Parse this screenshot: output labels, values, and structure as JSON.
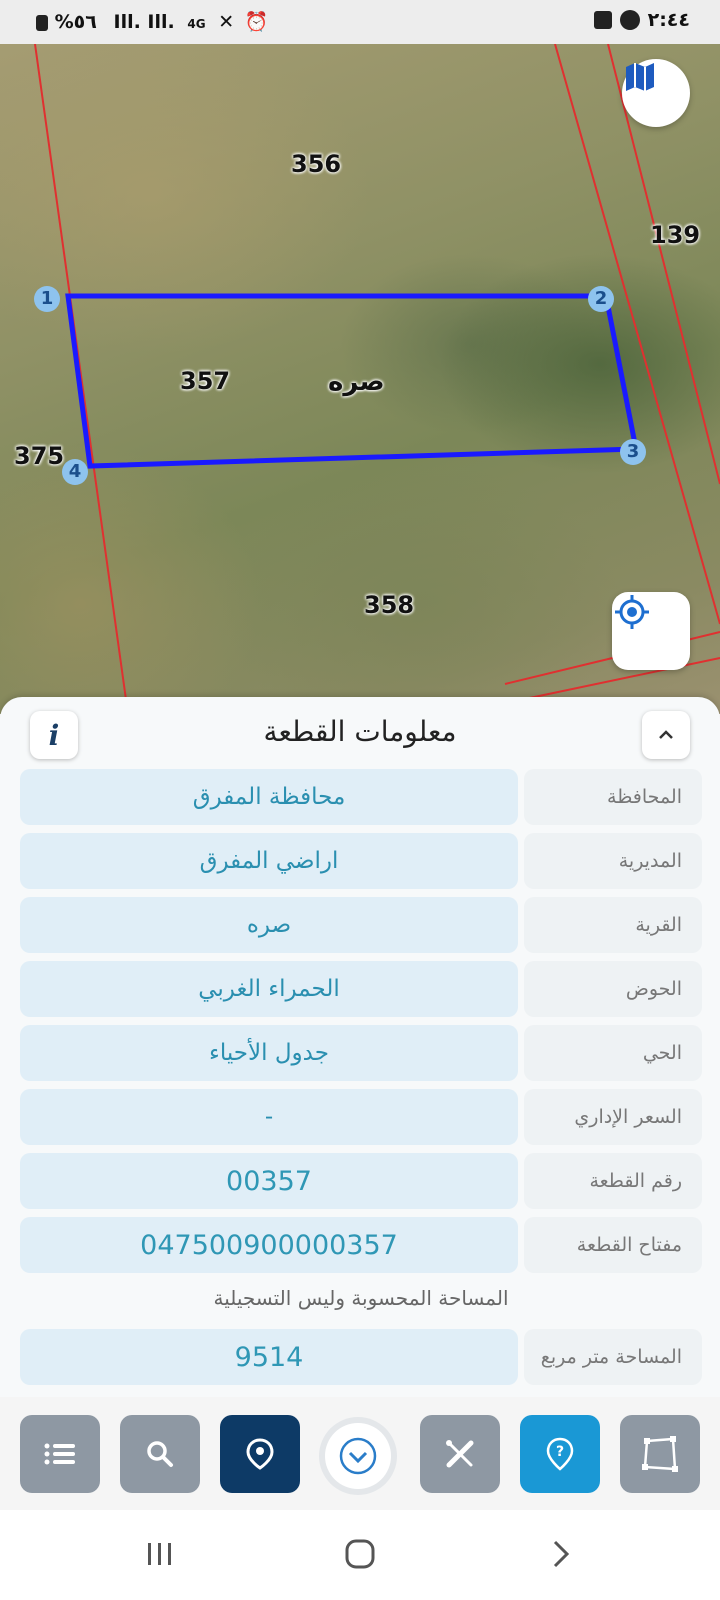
{
  "status_bar": {
    "time": "٢:٤٤",
    "battery": "%٥٦",
    "network": "4G"
  },
  "map": {
    "parcel_numbers": [
      "356",
      "139",
      "357",
      "375",
      "358"
    ],
    "area_name": "صره",
    "vertices": [
      "1",
      "2",
      "3",
      "4"
    ],
    "boundary_color": "#1a1aff",
    "cadastral_line_color": "#e03030",
    "map_type_icon": "map-icon",
    "locate_icon": "crosshair-icon"
  },
  "panel": {
    "title": "معلومات القطعة",
    "info_icon": "i",
    "collapse_icon": "chevron-up-icon",
    "rows": [
      {
        "label": "المحافظة",
        "value": "محافظة المفرق"
      },
      {
        "label": "المديرية",
        "value": "اراضي المفرق"
      },
      {
        "label": "القرية",
        "value": "صره"
      },
      {
        "label": "الحوض",
        "value": "الحمراء الغربي"
      },
      {
        "label": "الحي",
        "value": "جدول الأحياء"
      },
      {
        "label": "السعر الإداري",
        "value": "-"
      },
      {
        "label": "رقم القطعة",
        "value": "00357"
      },
      {
        "label": "مفتاح القطعة",
        "value": "047500900000357"
      }
    ],
    "area_note": "المساحة المحسوبة وليس التسجيلية",
    "area_row": {
      "label": "المساحة متر مربع",
      "value": "9514"
    }
  },
  "toolbar": {
    "buttons": [
      "list-icon",
      "search-icon",
      "location-pin-icon",
      "chevron-down-icon",
      "measure-icon",
      "help-icon",
      "polygon-icon"
    ],
    "active_color": "#0d3a66",
    "help_color": "#1a98d5",
    "default_color": "#8e98a3"
  },
  "nav": {
    "buttons": [
      "recents-icon",
      "home-icon",
      "back-icon"
    ]
  }
}
